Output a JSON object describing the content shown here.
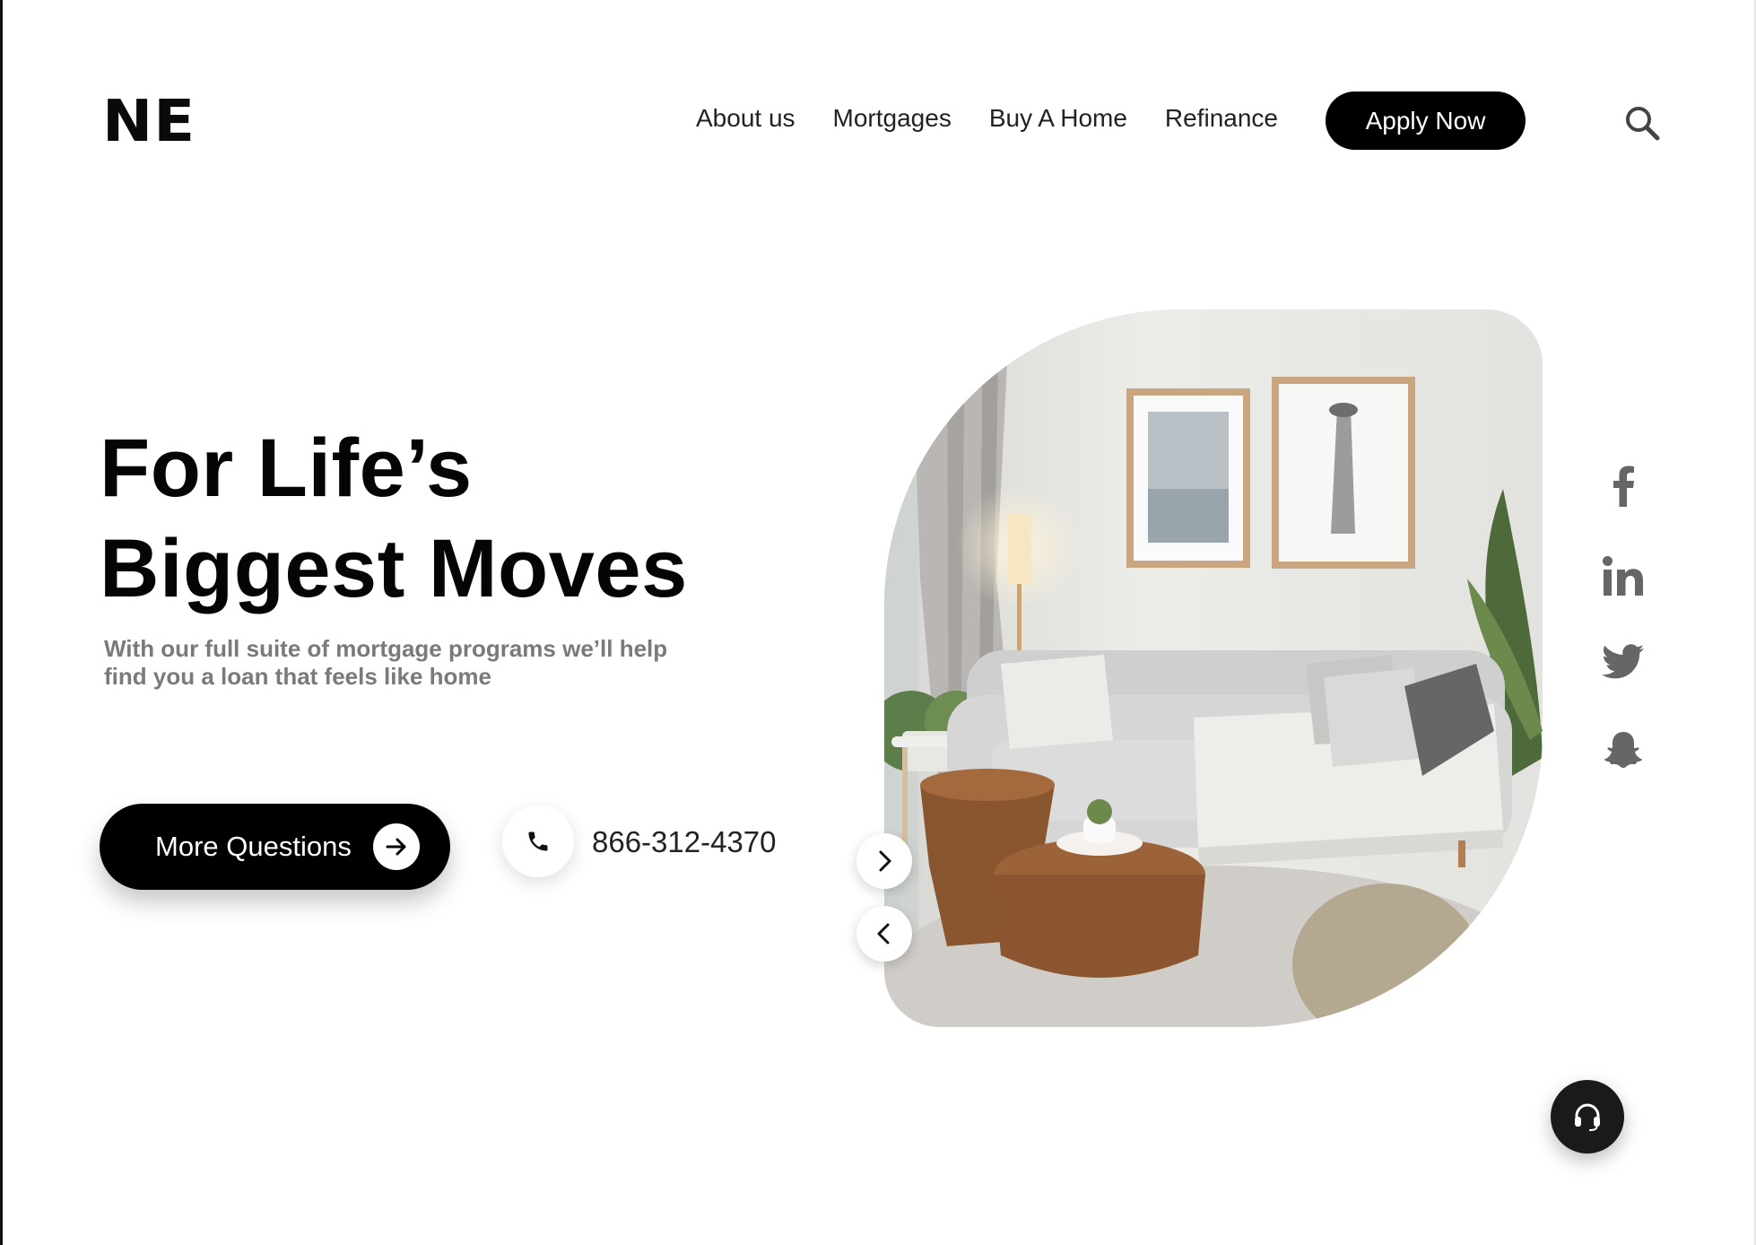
{
  "brand": {
    "logo_text": "NE"
  },
  "nav": {
    "items": [
      {
        "label": "About us"
      },
      {
        "label": "Mortgages"
      },
      {
        "label": "Buy A Home"
      },
      {
        "label": "Refinance"
      }
    ],
    "apply_label": "Apply Now",
    "search_icon": "search-icon"
  },
  "hero": {
    "title_line1": "For Life’s",
    "title_line2": "Biggest Moves",
    "subtitle_line1": "With our full suite of  mortgage programs we’ll help",
    "subtitle_line2": "find you a loan that feels like home",
    "cta_label": "More Questions",
    "cta_icon": "arrow-right-icon",
    "phone_icon": "phone-icon",
    "phone_number": "866-312-4370"
  },
  "carousel": {
    "next_icon": "chevron-right-icon",
    "prev_icon": "chevron-left-icon"
  },
  "social": [
    "facebook-icon",
    "linkedin-icon",
    "twitter-icon",
    "snapchat-icon"
  ],
  "support": {
    "icon": "headset-icon"
  },
  "colors": {
    "primary": "#000000",
    "text": "#222222",
    "muted": "#7a7a7a",
    "social": "#666666"
  }
}
